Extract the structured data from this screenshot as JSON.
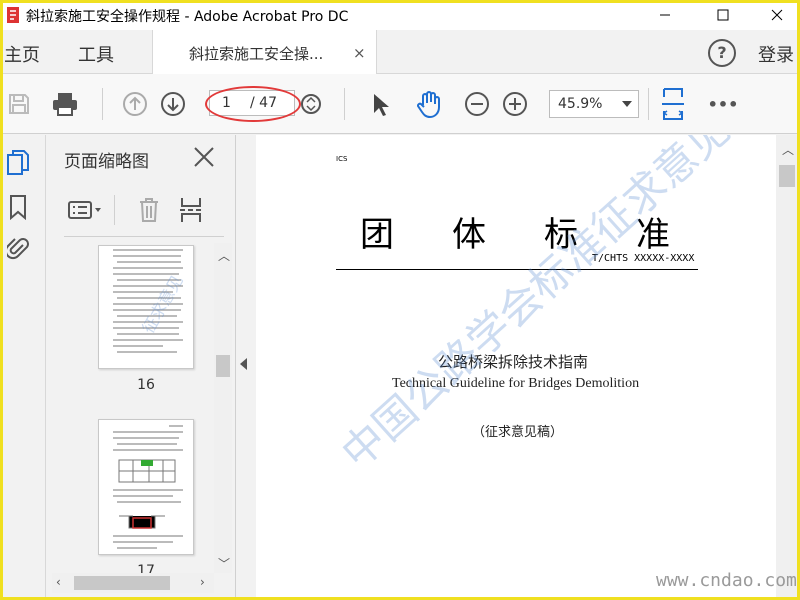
{
  "window": {
    "title": "斜拉索施工安全操作规程 - Adobe Acrobat Pro DC"
  },
  "menubar": {
    "home": "主页",
    "tools": "工具",
    "doc_tab": "斜拉索施工安全操...",
    "tab_close": "×",
    "help": "?",
    "login": "登录"
  },
  "toolbar": {
    "current_page": "1",
    "total_pages": "/ 47",
    "zoom": "45.9%",
    "more": "•••"
  },
  "panel": {
    "title": "页面缩略图",
    "thumbnails": [
      {
        "page": "16"
      },
      {
        "page": "17"
      }
    ]
  },
  "document": {
    "ics": "ICS",
    "title_chars": [
      "团",
      "体",
      "标",
      "准"
    ],
    "standard_number": "T/CHTS XXXXX-XXXX",
    "title_cn": "公路桥梁拆除技术指南",
    "title_en": "Technical Guideline for Bridges Demolition",
    "draft": "（征求意见稿）",
    "watermark": "中国公路学会标准征求意见稿"
  },
  "footer": {
    "site": "www.cndao.com"
  },
  "colors": {
    "accent_blue": "#1f6fd1",
    "highlight_red": "#e23a3a",
    "frame_yellow": "#f0e020"
  }
}
